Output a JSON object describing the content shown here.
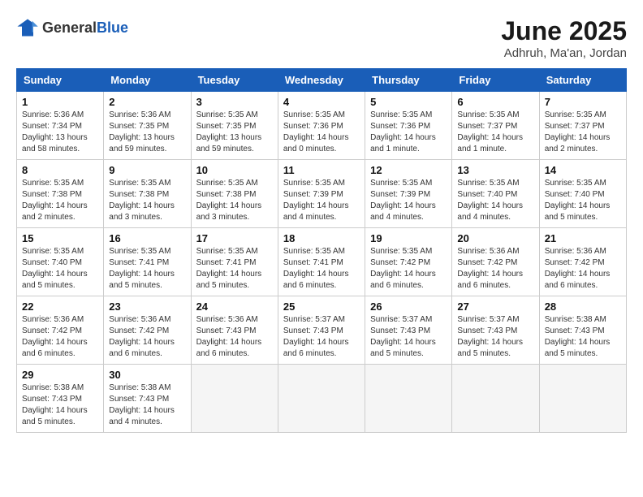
{
  "header": {
    "logo_general": "General",
    "logo_blue": "Blue",
    "month_title": "June 2025",
    "location": "Adhruh, Ma'an, Jordan"
  },
  "weekdays": [
    "Sunday",
    "Monday",
    "Tuesday",
    "Wednesday",
    "Thursday",
    "Friday",
    "Saturday"
  ],
  "weeks": [
    [
      {
        "day": "1",
        "info": "Sunrise: 5:36 AM\nSunset: 7:34 PM\nDaylight: 13 hours\nand 58 minutes."
      },
      {
        "day": "2",
        "info": "Sunrise: 5:36 AM\nSunset: 7:35 PM\nDaylight: 13 hours\nand 59 minutes."
      },
      {
        "day": "3",
        "info": "Sunrise: 5:35 AM\nSunset: 7:35 PM\nDaylight: 13 hours\nand 59 minutes."
      },
      {
        "day": "4",
        "info": "Sunrise: 5:35 AM\nSunset: 7:36 PM\nDaylight: 14 hours\nand 0 minutes."
      },
      {
        "day": "5",
        "info": "Sunrise: 5:35 AM\nSunset: 7:36 PM\nDaylight: 14 hours\nand 1 minute."
      },
      {
        "day": "6",
        "info": "Sunrise: 5:35 AM\nSunset: 7:37 PM\nDaylight: 14 hours\nand 1 minute."
      },
      {
        "day": "7",
        "info": "Sunrise: 5:35 AM\nSunset: 7:37 PM\nDaylight: 14 hours\nand 2 minutes."
      }
    ],
    [
      {
        "day": "8",
        "info": "Sunrise: 5:35 AM\nSunset: 7:38 PM\nDaylight: 14 hours\nand 2 minutes."
      },
      {
        "day": "9",
        "info": "Sunrise: 5:35 AM\nSunset: 7:38 PM\nDaylight: 14 hours\nand 3 minutes."
      },
      {
        "day": "10",
        "info": "Sunrise: 5:35 AM\nSunset: 7:38 PM\nDaylight: 14 hours\nand 3 minutes."
      },
      {
        "day": "11",
        "info": "Sunrise: 5:35 AM\nSunset: 7:39 PM\nDaylight: 14 hours\nand 4 minutes."
      },
      {
        "day": "12",
        "info": "Sunrise: 5:35 AM\nSunset: 7:39 PM\nDaylight: 14 hours\nand 4 minutes."
      },
      {
        "day": "13",
        "info": "Sunrise: 5:35 AM\nSunset: 7:40 PM\nDaylight: 14 hours\nand 4 minutes."
      },
      {
        "day": "14",
        "info": "Sunrise: 5:35 AM\nSunset: 7:40 PM\nDaylight: 14 hours\nand 5 minutes."
      }
    ],
    [
      {
        "day": "15",
        "info": "Sunrise: 5:35 AM\nSunset: 7:40 PM\nDaylight: 14 hours\nand 5 minutes."
      },
      {
        "day": "16",
        "info": "Sunrise: 5:35 AM\nSunset: 7:41 PM\nDaylight: 14 hours\nand 5 minutes."
      },
      {
        "day": "17",
        "info": "Sunrise: 5:35 AM\nSunset: 7:41 PM\nDaylight: 14 hours\nand 5 minutes."
      },
      {
        "day": "18",
        "info": "Sunrise: 5:35 AM\nSunset: 7:41 PM\nDaylight: 14 hours\nand 6 minutes."
      },
      {
        "day": "19",
        "info": "Sunrise: 5:35 AM\nSunset: 7:42 PM\nDaylight: 14 hours\nand 6 minutes."
      },
      {
        "day": "20",
        "info": "Sunrise: 5:36 AM\nSunset: 7:42 PM\nDaylight: 14 hours\nand 6 minutes."
      },
      {
        "day": "21",
        "info": "Sunrise: 5:36 AM\nSunset: 7:42 PM\nDaylight: 14 hours\nand 6 minutes."
      }
    ],
    [
      {
        "day": "22",
        "info": "Sunrise: 5:36 AM\nSunset: 7:42 PM\nDaylight: 14 hours\nand 6 minutes."
      },
      {
        "day": "23",
        "info": "Sunrise: 5:36 AM\nSunset: 7:42 PM\nDaylight: 14 hours\nand 6 minutes."
      },
      {
        "day": "24",
        "info": "Sunrise: 5:36 AM\nSunset: 7:43 PM\nDaylight: 14 hours\nand 6 minutes."
      },
      {
        "day": "25",
        "info": "Sunrise: 5:37 AM\nSunset: 7:43 PM\nDaylight: 14 hours\nand 6 minutes."
      },
      {
        "day": "26",
        "info": "Sunrise: 5:37 AM\nSunset: 7:43 PM\nDaylight: 14 hours\nand 5 minutes."
      },
      {
        "day": "27",
        "info": "Sunrise: 5:37 AM\nSunset: 7:43 PM\nDaylight: 14 hours\nand 5 minutes."
      },
      {
        "day": "28",
        "info": "Sunrise: 5:38 AM\nSunset: 7:43 PM\nDaylight: 14 hours\nand 5 minutes."
      }
    ],
    [
      {
        "day": "29",
        "info": "Sunrise: 5:38 AM\nSunset: 7:43 PM\nDaylight: 14 hours\nand 5 minutes."
      },
      {
        "day": "30",
        "info": "Sunrise: 5:38 AM\nSunset: 7:43 PM\nDaylight: 14 hours\nand 4 minutes."
      },
      {
        "day": "",
        "info": ""
      },
      {
        "day": "",
        "info": ""
      },
      {
        "day": "",
        "info": ""
      },
      {
        "day": "",
        "info": ""
      },
      {
        "day": "",
        "info": ""
      }
    ]
  ]
}
